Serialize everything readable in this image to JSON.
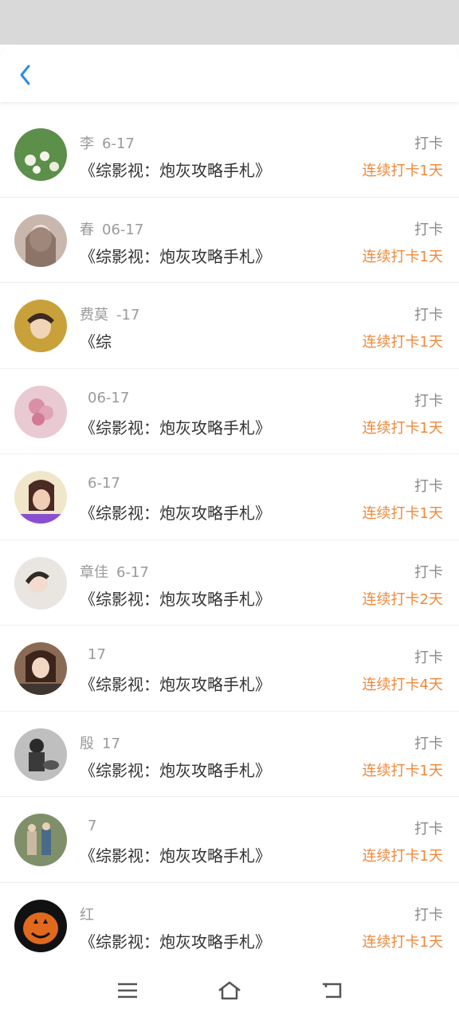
{
  "items": [
    {
      "name": "李",
      "date": "6-17",
      "title": "《综影视：炮灰攻略手札》",
      "action": "打卡",
      "streak": "连续打卡1天",
      "avatar_color": "#5c8f4a"
    },
    {
      "name": "春",
      "date": "06-17",
      "title": "《综影视：炮灰攻略手札》",
      "action": "打卡",
      "streak": "连续打卡1天",
      "avatar_color": "#c9b7ad"
    },
    {
      "name": "费莫",
      "date": "-17",
      "title": "《综",
      "action": "打卡",
      "streak": "连续打卡1天",
      "avatar_color": "#c9a13a"
    },
    {
      "name": "",
      "date": "06-17",
      "title": "《综影视：炮灰攻略手札》",
      "action": "打卡",
      "streak": "连续打卡1天",
      "avatar_color": "#d98fa6"
    },
    {
      "name": "",
      "date": "6-17",
      "title": "《综影视：炮灰攻略手札》",
      "action": "打卡",
      "streak": "连续打卡1天",
      "avatar_color": "#a05a5a"
    },
    {
      "name": "章佳",
      "date": "6-17",
      "title": "《综影视：炮灰攻略手札》",
      "action": "打卡",
      "streak": "连续打卡2天",
      "avatar_color": "#d8d3cf"
    },
    {
      "name": "",
      "date": "17",
      "title": "《综影视：炮灰攻略手札》",
      "action": "打卡",
      "streak": "连续打卡4天",
      "avatar_color": "#8a6a55"
    },
    {
      "name": "殷",
      "date": "17",
      "title": "《综影视：炮灰攻略手札》",
      "action": "打卡",
      "streak": "连续打卡1天",
      "avatar_color": "#4a4a4a"
    },
    {
      "name": "",
      "date": "7",
      "title": "《综影视：炮灰攻略手札》",
      "action": "打卡",
      "streak": "连续打卡1天",
      "avatar_color": "#7f8f6a"
    },
    {
      "name": "红",
      "date": "",
      "title": "《综影视：炮灰攻略手札》",
      "action": "打卡",
      "streak": "连续打卡1天",
      "avatar_color": "#e0691d"
    }
  ],
  "colors": {
    "accent_back": "#2a8ee0",
    "streak": "#f0883a"
  },
  "icons": {
    "back": "chevron-left-icon",
    "menu": "menu-icon",
    "home": "home-icon",
    "return": "return-icon"
  }
}
